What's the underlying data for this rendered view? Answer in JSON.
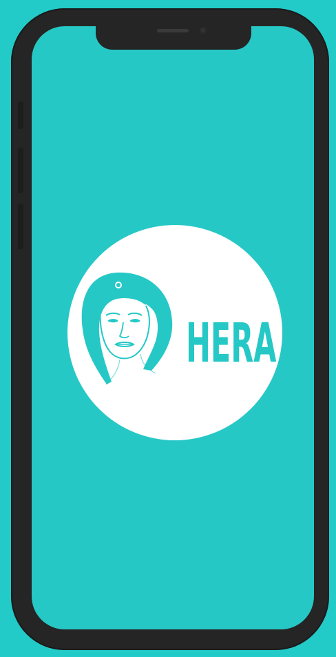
{
  "app": {
    "brand_name": "HERA"
  },
  "colors": {
    "background": "#22cbc8",
    "screen": "#26c8c6",
    "phone_frame": "#252525",
    "logo_circle": "#ffffff",
    "brand_accent": "#26c8c6"
  },
  "icons": {
    "logo_mark": "woman-portrait-icon"
  }
}
